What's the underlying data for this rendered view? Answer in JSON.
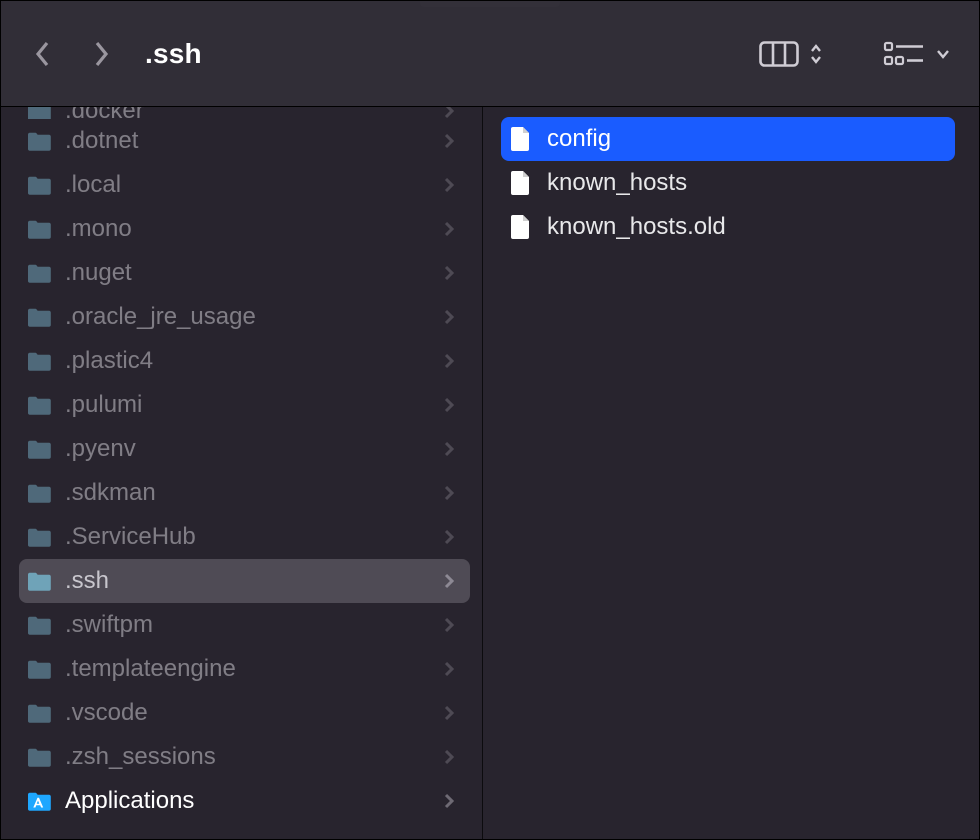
{
  "toolbar": {
    "title": ".ssh"
  },
  "left_column": {
    "cut_item": {
      "name": ".docker",
      "type": "folder"
    },
    "items": [
      {
        "name": ".dotnet",
        "type": "folder"
      },
      {
        "name": ".local",
        "type": "folder"
      },
      {
        "name": ".mono",
        "type": "folder"
      },
      {
        "name": ".nuget",
        "type": "folder"
      },
      {
        "name": ".oracle_jre_usage",
        "type": "folder"
      },
      {
        "name": ".plastic4",
        "type": "folder"
      },
      {
        "name": ".pulumi",
        "type": "folder"
      },
      {
        "name": ".pyenv",
        "type": "folder"
      },
      {
        "name": ".sdkman",
        "type": "folder"
      },
      {
        "name": ".ServiceHub",
        "type": "folder"
      },
      {
        "name": ".ssh",
        "type": "folder",
        "active": true
      },
      {
        "name": ".swiftpm",
        "type": "folder"
      },
      {
        "name": ".templateengine",
        "type": "folder"
      },
      {
        "name": ".vscode",
        "type": "folder"
      },
      {
        "name": ".zsh_sessions",
        "type": "folder"
      },
      {
        "name": "Applications",
        "type": "app-folder"
      }
    ]
  },
  "right_column": {
    "items": [
      {
        "name": "config",
        "type": "file",
        "selected": true
      },
      {
        "name": "known_hosts",
        "type": "file"
      },
      {
        "name": "known_hosts.old",
        "type": "file"
      }
    ]
  },
  "colors": {
    "toolbar_bg": "#312e37",
    "content_bg": "#28242e",
    "selection_blue": "#1a5cff",
    "folder_tint": "#6fa3b8"
  }
}
